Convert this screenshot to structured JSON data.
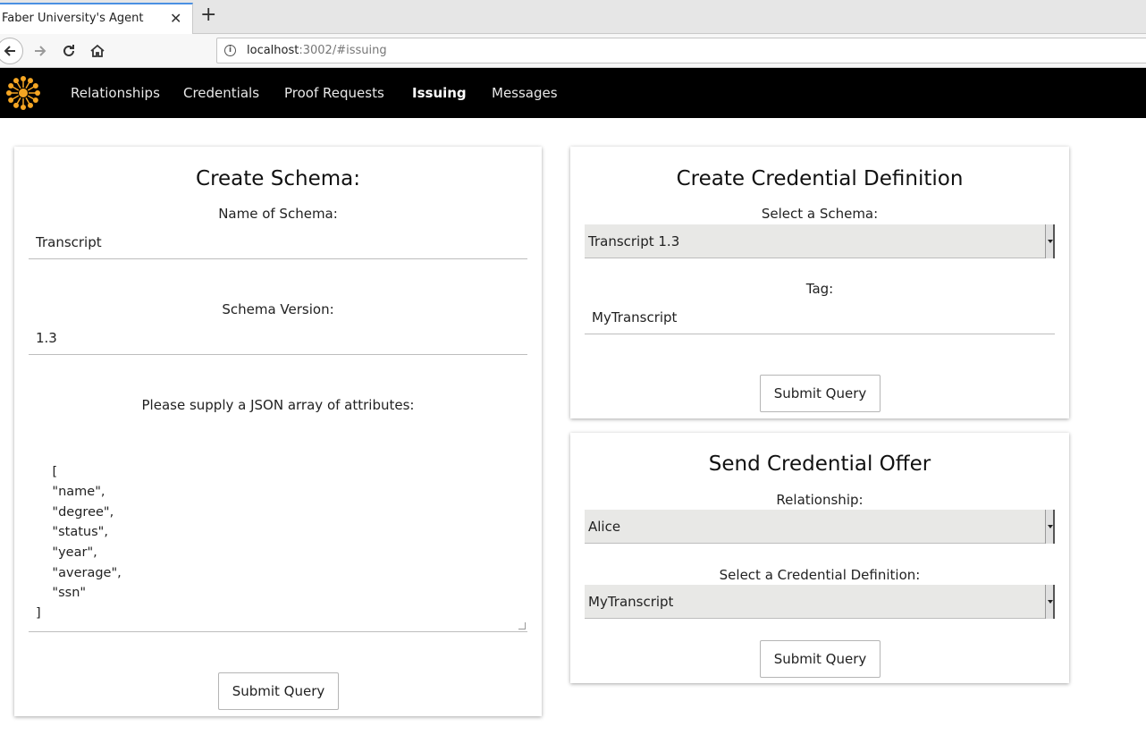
{
  "browser": {
    "tab_title": "Faber University's Agent",
    "close_glyph": "✕",
    "new_tab_glyph": "+",
    "url_host": "localhost",
    "url_rest": ":3002/#issuing",
    "info_glyph": "i",
    "icons": [
      "back-arrow-icon",
      "forward-arrow-icon",
      "reload-icon",
      "home-icon",
      "info-icon"
    ]
  },
  "app_nav": {
    "items": [
      {
        "label": "Relationships"
      },
      {
        "label": "Credentials"
      },
      {
        "label": "Proof Requests"
      },
      {
        "label": "Issuing",
        "active": true
      },
      {
        "label": "Messages"
      }
    ],
    "logo_color": "#f5a623"
  },
  "create_schema": {
    "title": "Create Schema:",
    "name_label": "Name of Schema:",
    "name_value": "Transcript",
    "version_label": "Schema Version:",
    "version_value": "1.3",
    "attributes_label": "Please supply a JSON array of attributes:",
    "attributes_value": "[\n    \"name\",\n    \"degree\",\n    \"status\",\n    \"year\",\n    \"average\",\n    \"ssn\"\n]",
    "submit_label": "Submit Query"
  },
  "create_cred_def": {
    "title": "Create Credential Definition",
    "schema_label": "Select a Schema:",
    "schema_value": "Transcript 1.3",
    "tag_label": "Tag:",
    "tag_value": "MyTranscript",
    "submit_label": "Submit Query"
  },
  "send_offer": {
    "title": "Send Credential Offer",
    "relationship_label": "Relationship:",
    "relationship_value": "Alice",
    "cred_def_label": "Select a Credential Definition:",
    "cred_def_value": "MyTranscript",
    "submit_label": "Submit Query"
  }
}
